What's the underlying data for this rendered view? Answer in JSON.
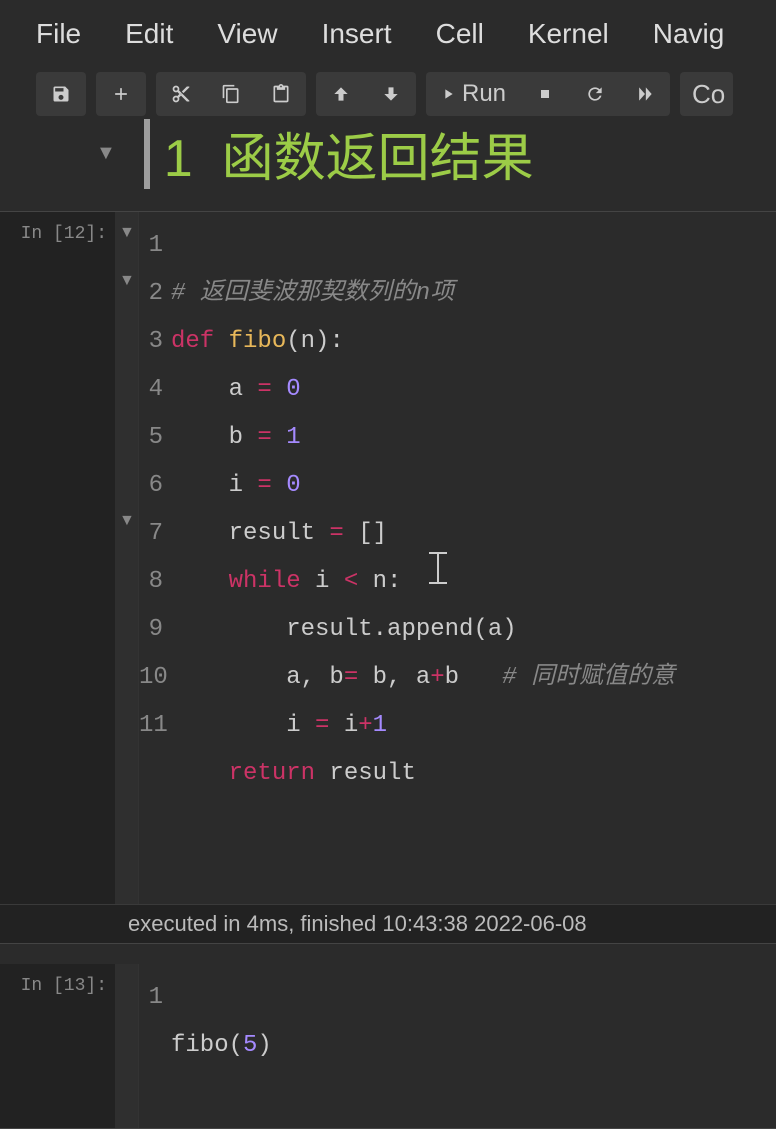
{
  "menu": {
    "file": "File",
    "edit": "Edit",
    "view": "View",
    "insert": "Insert",
    "cell": "Cell",
    "kernel": "Kernel",
    "navigate": "Navig"
  },
  "toolbar": {
    "run_label": "Run",
    "celltype": "Co"
  },
  "heading": {
    "number": "1",
    "title": "函数返回结果"
  },
  "cell1": {
    "prompt": "In [12]:",
    "lines": [
      "1",
      "2",
      "3",
      "4",
      "5",
      "6",
      "7",
      "8",
      "9",
      "10",
      "11"
    ],
    "code": {
      "l1_comment": "# 返回斐波那契数列的n项",
      "l2_def": "def",
      "l2_func": "fibo",
      "l2_rest": "(n):",
      "l3_var": "a",
      "l3_eq": " = ",
      "l3_val": "0",
      "l4_var": "b",
      "l4_eq": " = ",
      "l4_val": "1",
      "l5_var": "i",
      "l5_eq": " = ",
      "l5_val": "0",
      "l6_var": "result",
      "l6_eq": " = ",
      "l6_val": "[]",
      "l7_while": "while",
      "l7_rest_a": " i ",
      "l7_lt": "<",
      "l7_rest_b": " n:",
      "l8_text": "result.append(a)",
      "l9_a": "a, b",
      "l9_eq": "=",
      "l9_b": " b, a",
      "l9_plus": "+",
      "l9_c": "b",
      "l9_comment": "# 同时赋值的意",
      "l10_a": "i ",
      "l10_eq": "=",
      "l10_b": " i",
      "l10_plus": "+",
      "l10_num": "1",
      "l11_return": "return",
      "l11_rest": " result"
    },
    "exec_info": "executed in 4ms, finished 10:43:38 2022-06-08"
  },
  "cell2": {
    "prompt": "In [13]:",
    "lines": [
      "1"
    ],
    "code": {
      "l1_a": "fibo(",
      "l1_num": "5",
      "l1_b": ")"
    }
  }
}
